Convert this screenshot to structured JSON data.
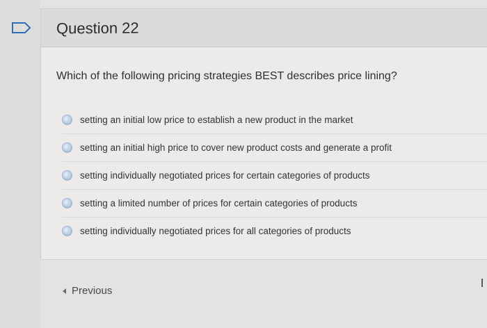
{
  "question": {
    "title": "Question 22",
    "prompt": "Which of the following pricing strategies BEST describes price lining?",
    "options": [
      {
        "label": "setting an initial low price to establish a new product in the market"
      },
      {
        "label": "setting an initial high price to cover new product costs and generate a profit"
      },
      {
        "label": "setting individually negotiated prices for certain categories of products"
      },
      {
        "label": "setting a limited number of prices for certain categories of products"
      },
      {
        "label": "setting individually negotiated prices for all categories of products"
      }
    ]
  },
  "navigation": {
    "previous_label": "Previous"
  },
  "colors": {
    "flag_stroke": "#2f6fb5",
    "radio": "#b9cfe3"
  },
  "icons": {
    "flag": "flag-icon",
    "previous": "left-arrow-icon"
  }
}
